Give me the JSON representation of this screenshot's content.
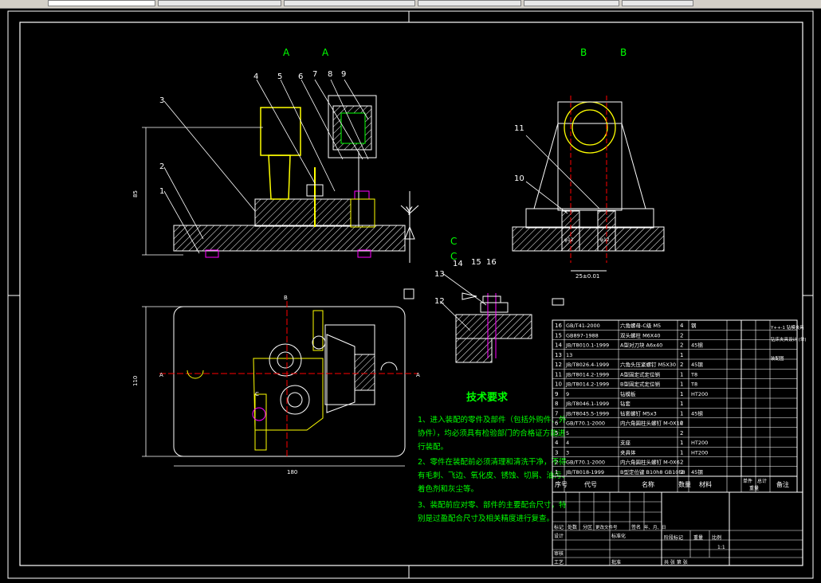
{
  "tabs": [
    {
      "label": "",
      "active": true
    },
    {
      "label": "",
      "active": false
    },
    {
      "label": "",
      "active": false
    },
    {
      "label": "",
      "active": false
    },
    {
      "label": "",
      "active": false
    },
    {
      "label": "",
      "active": false
    }
  ],
  "views": {
    "section_a_left": "A",
    "section_a_right": "A",
    "section_b_left": "B",
    "section_b_right": "B",
    "section_c_top": "C",
    "section_c_bottom": "C",
    "axis_y": "Y",
    "dim_height_front": "85",
    "dim_height_top": "110",
    "dim_width_top": "180",
    "dim_side": "25±0.01",
    "dim_fit_1": "φ12",
    "dim_fit_2": "φ12",
    "mark_b": "B",
    "mark_a_left": "A",
    "mark_a_right": "A",
    "mark_c": "C"
  },
  "callouts": [
    "1",
    "2",
    "3",
    "4",
    "5",
    "6",
    "7",
    "8",
    "9",
    "10",
    "11",
    "12",
    "13",
    "14",
    "15",
    "16"
  ],
  "tech": {
    "title": "技术要求",
    "lines": [
      "1、进入装配的零件及部件（包括外购件、外",
      "协件），均必须具有检验部门的合格证方能进",
      "行装配。",
      "2、零件在装配前必须清理和清洗干净，不得",
      "有毛刺、飞边、氧化皮、锈蚀、切屑、油污、",
      "着色剂和灰尘等。",
      "3、装配前应对零、部件的主要配合尺寸，特",
      "别是过盈配合尺寸及相关精度进行复查。"
    ]
  },
  "bom": {
    "rows": [
      {
        "no": "16",
        "code": "GB/T41-2000",
        "name": "六角螺母-C级 M5",
        "qty": "4",
        "mat": "钢",
        "note": ""
      },
      {
        "no": "15",
        "code": "GB897-1988",
        "name": "双头螺柱 M6X40",
        "qty": "2",
        "mat": "",
        "note": ""
      },
      {
        "no": "14",
        "code": "JB/T8010.1-1999",
        "name": "A型对刀块 A6x40",
        "qty": "2",
        "mat": "45钢",
        "note": ""
      },
      {
        "no": "13",
        "code": "13",
        "name": "",
        "qty": "1",
        "mat": "",
        "note": ""
      },
      {
        "no": "12",
        "code": "JB/T8026.4-1999",
        "name": "六角头压紧螺钉 M5X30",
        "qty": "2",
        "mat": "45钢",
        "note": ""
      },
      {
        "no": "11",
        "code": "JB/T8014.2-1999",
        "name": "A型固定式定位销",
        "qty": "1",
        "mat": "T8",
        "note": ""
      },
      {
        "no": "10",
        "code": "JB/T8014.2-1999",
        "name": "B型固定式定位销",
        "qty": "1",
        "mat": "T8",
        "note": ""
      },
      {
        "no": "9",
        "code": "9",
        "name": "钻模板",
        "qty": "1",
        "mat": "HT200",
        "note": ""
      },
      {
        "no": "8",
        "code": "JB/T8046.1-1999",
        "name": "钻套",
        "qty": "1",
        "mat": "",
        "note": ""
      },
      {
        "no": "7",
        "code": "JB/T8045.5-1999",
        "name": "钻套螺钉 M5x3",
        "qty": "1",
        "mat": "45钢",
        "note": ""
      },
      {
        "no": "6",
        "code": "GB/T70.1-2000",
        "name": "内六角圆柱头螺钉 M-0X16",
        "qty": "2",
        "mat": "",
        "note": ""
      },
      {
        "no": "5",
        "code": "5",
        "name": "",
        "qty": "2",
        "mat": "",
        "note": ""
      },
      {
        "no": "4",
        "code": "4",
        "name": "支座",
        "qty": "1",
        "mat": "HT200",
        "note": ""
      },
      {
        "no": "3",
        "code": "3",
        "name": "夹具体",
        "qty": "1",
        "mat": "HT200",
        "note": ""
      },
      {
        "no": "2",
        "code": "GB/T70.1-2000",
        "name": "内六角圆柱头螺钉 M-0X6",
        "qty": "2",
        "mat": "",
        "note": ""
      },
      {
        "no": "1",
        "code": "JB/T8018-1999",
        "name": "B型定位键 B10h8 GB10h8",
        "qty": "2",
        "mat": "45钢",
        "note": ""
      }
    ],
    "header": {
      "no": "序号",
      "code": "代号",
      "name": "名称",
      "qty": "数量",
      "mat": "材料",
      "single": "单件",
      "total": "总计",
      "weight": "重量",
      "note": "备注"
    }
  },
  "titleblock": {
    "mark": "标记",
    "count": "处数",
    "zone": "分区",
    "docno": "更改文件号",
    "sign": "签名",
    "date": "年、月、日",
    "design": "设计",
    "standard": "标准化",
    "stage": "阶段标记",
    "weight": "重量",
    "scale": "比例",
    "scale_value": "1:1",
    "review": "审核",
    "process": "工艺",
    "approve": "批准",
    "sheets": "共 张 第 张",
    "side_title": "Y++-1 钻模夹具",
    "side_line2": "钻床夹具设计 (单)",
    "side_line3": "装配图"
  },
  "colors": {
    "line": "#ffffff",
    "hatch": "#ffffff",
    "accent_green": "#00ff00",
    "accent_yellow": "#ffff00",
    "accent_magenta": "#ff00ff"
  }
}
